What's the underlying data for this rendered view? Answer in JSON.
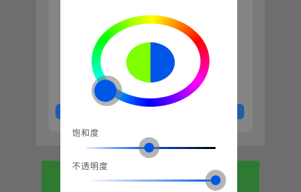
{
  "colors": {
    "selected": "#0057e7",
    "compare": "#7fff00",
    "track_end": "#000000"
  },
  "sliders": {
    "saturation": {
      "label": "饱和度",
      "value": 0.44
    },
    "opacity": {
      "label": "不透明度",
      "value": 1.0
    }
  }
}
